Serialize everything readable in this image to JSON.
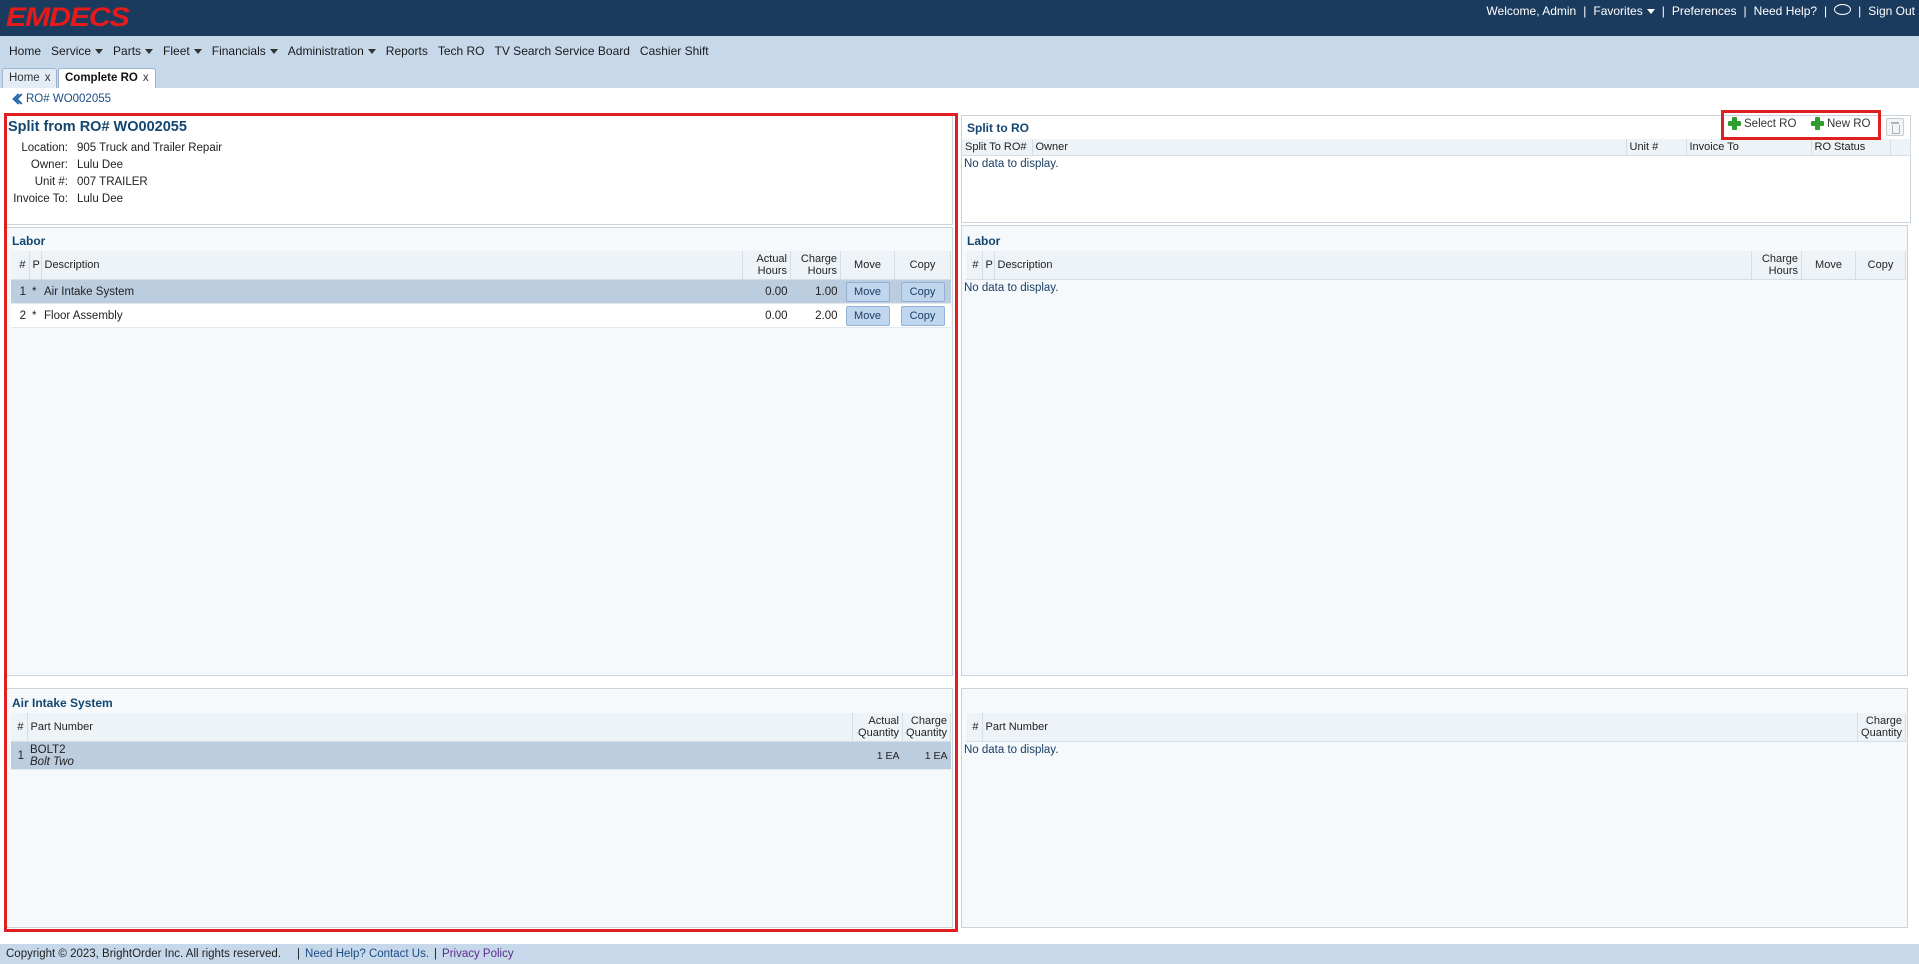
{
  "header": {
    "logo_text": "EMDECS",
    "welcome": "Welcome, Admin",
    "favorites": "Favorites",
    "preferences": "Preferences",
    "need_help": "Need Help?",
    "sign_out": "Sign Out",
    "separator": "|"
  },
  "menu": {
    "items": [
      {
        "label": "Home",
        "dropdown": false
      },
      {
        "label": "Service",
        "dropdown": true
      },
      {
        "label": "Parts",
        "dropdown": true
      },
      {
        "label": "Fleet",
        "dropdown": true
      },
      {
        "label": "Financials",
        "dropdown": true
      },
      {
        "label": "Administration",
        "dropdown": true
      },
      {
        "label": "Reports",
        "dropdown": false
      },
      {
        "label": "Tech RO",
        "dropdown": false
      },
      {
        "label": "TV Search Service Board",
        "dropdown": false
      },
      {
        "label": "Cashier Shift",
        "dropdown": false
      }
    ]
  },
  "tabs": [
    {
      "label": "Home",
      "active": false
    },
    {
      "label": "Complete RO",
      "active": true
    }
  ],
  "tab_close": "x",
  "breadcrumb": "RO# WO002055",
  "left": {
    "title": "Split from RO# WO002055",
    "info": {
      "location_label": "Location:",
      "location": "905 Truck and Trailer Repair",
      "owner_label": "Owner:",
      "owner": "Lulu Dee",
      "unit_label": "Unit #:",
      "unit": "007 TRAILER",
      "invoice_label": "Invoice To:",
      "invoice": "Lulu Dee"
    },
    "labor": {
      "title": "Labor",
      "headers": {
        "num": "#",
        "p": "P",
        "desc": "Description",
        "actual1": "Actual",
        "actual2": "Hours",
        "charge1": "Charge",
        "charge2": "Hours",
        "move": "Move",
        "copy": "Copy"
      },
      "rows": [
        {
          "num": "1",
          "p": "*",
          "desc": "Air Intake System",
          "actual": "0.00",
          "charge": "1.00",
          "move": "Move",
          "copy": "Copy"
        },
        {
          "num": "2",
          "p": "*",
          "desc": "Floor Assembly",
          "actual": "0.00",
          "charge": "2.00",
          "move": "Move",
          "copy": "Copy"
        }
      ]
    },
    "parts": {
      "title": "Air Intake System",
      "headers": {
        "num": "#",
        "part": "Part Number",
        "actual1": "Actual",
        "actual2": "Quantity",
        "charge1": "Charge",
        "charge2": "Quantity"
      },
      "rows": [
        {
          "num": "1",
          "part": "BOLT2",
          "part_desc": "Bolt Two",
          "actual": "1 EA",
          "charge": "1 EA"
        }
      ]
    }
  },
  "right": {
    "title": "Split to RO",
    "select_ro": "Select RO",
    "new_ro": "New RO",
    "split_headers": {
      "ro": "Split To RO#",
      "owner": "Owner",
      "unit": "Unit #",
      "invoice": "Invoice To",
      "status": "RO Status"
    },
    "no_data": "No data to display.",
    "labor": {
      "title": "Labor",
      "headers": {
        "num": "#",
        "p": "P",
        "desc": "Description",
        "charge1": "Charge",
        "charge2": "Hours",
        "move": "Move",
        "copy": "Copy"
      }
    },
    "parts": {
      "headers": {
        "num": "#",
        "part": "Part Number",
        "charge1": "Charge",
        "charge2": "Quantity"
      }
    }
  },
  "footer": {
    "copyright": "Copyright © 2023, BrightOrder Inc. All rights reserved.",
    "sep": "|",
    "help": "Need Help? Contact Us.",
    "privacy": "Privacy Policy"
  }
}
